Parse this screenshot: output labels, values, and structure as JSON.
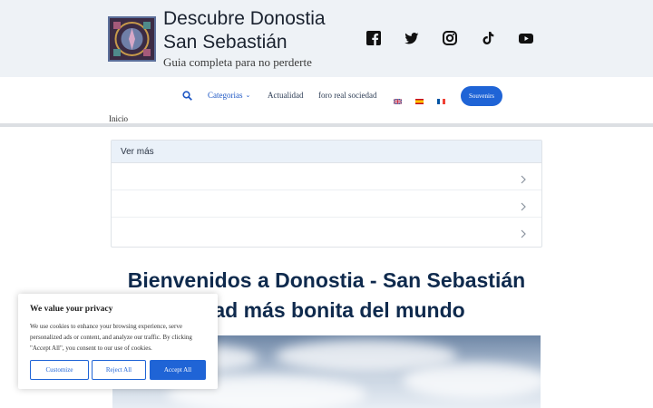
{
  "header": {
    "title_line1": "Descubre Donostia",
    "title_line2": "San Sebastián",
    "tagline": "Guia completa para no perderte",
    "social": [
      "facebook-icon",
      "twitter-icon",
      "instagram-icon",
      "tiktok-icon",
      "youtube-icon"
    ]
  },
  "nav": {
    "items": [
      "Categorias",
      "Actualidad",
      "foro real sociedad"
    ],
    "flags": [
      "english-flag",
      "spanish-flag",
      "french-flag"
    ],
    "cta": "Souvenirs",
    "accent": "#1f64d6"
  },
  "breadcrumb": "Inicio",
  "accordion": {
    "title": "Ver más",
    "rows": 3
  },
  "main": {
    "heading_line1": "Bienvenidos a Donostia - San Sebastián",
    "heading_line2": "udad más bonita del mundo"
  },
  "cookie": {
    "title": "We value your privacy",
    "text": "We use cookies to enhance your browsing experience, serve personalized ads or content, and analyze our traffic. By clicking \"Accept All\", you consent to our use of cookies.",
    "customize": "Customize",
    "reject": "Reject All",
    "accept": "Accept All"
  }
}
